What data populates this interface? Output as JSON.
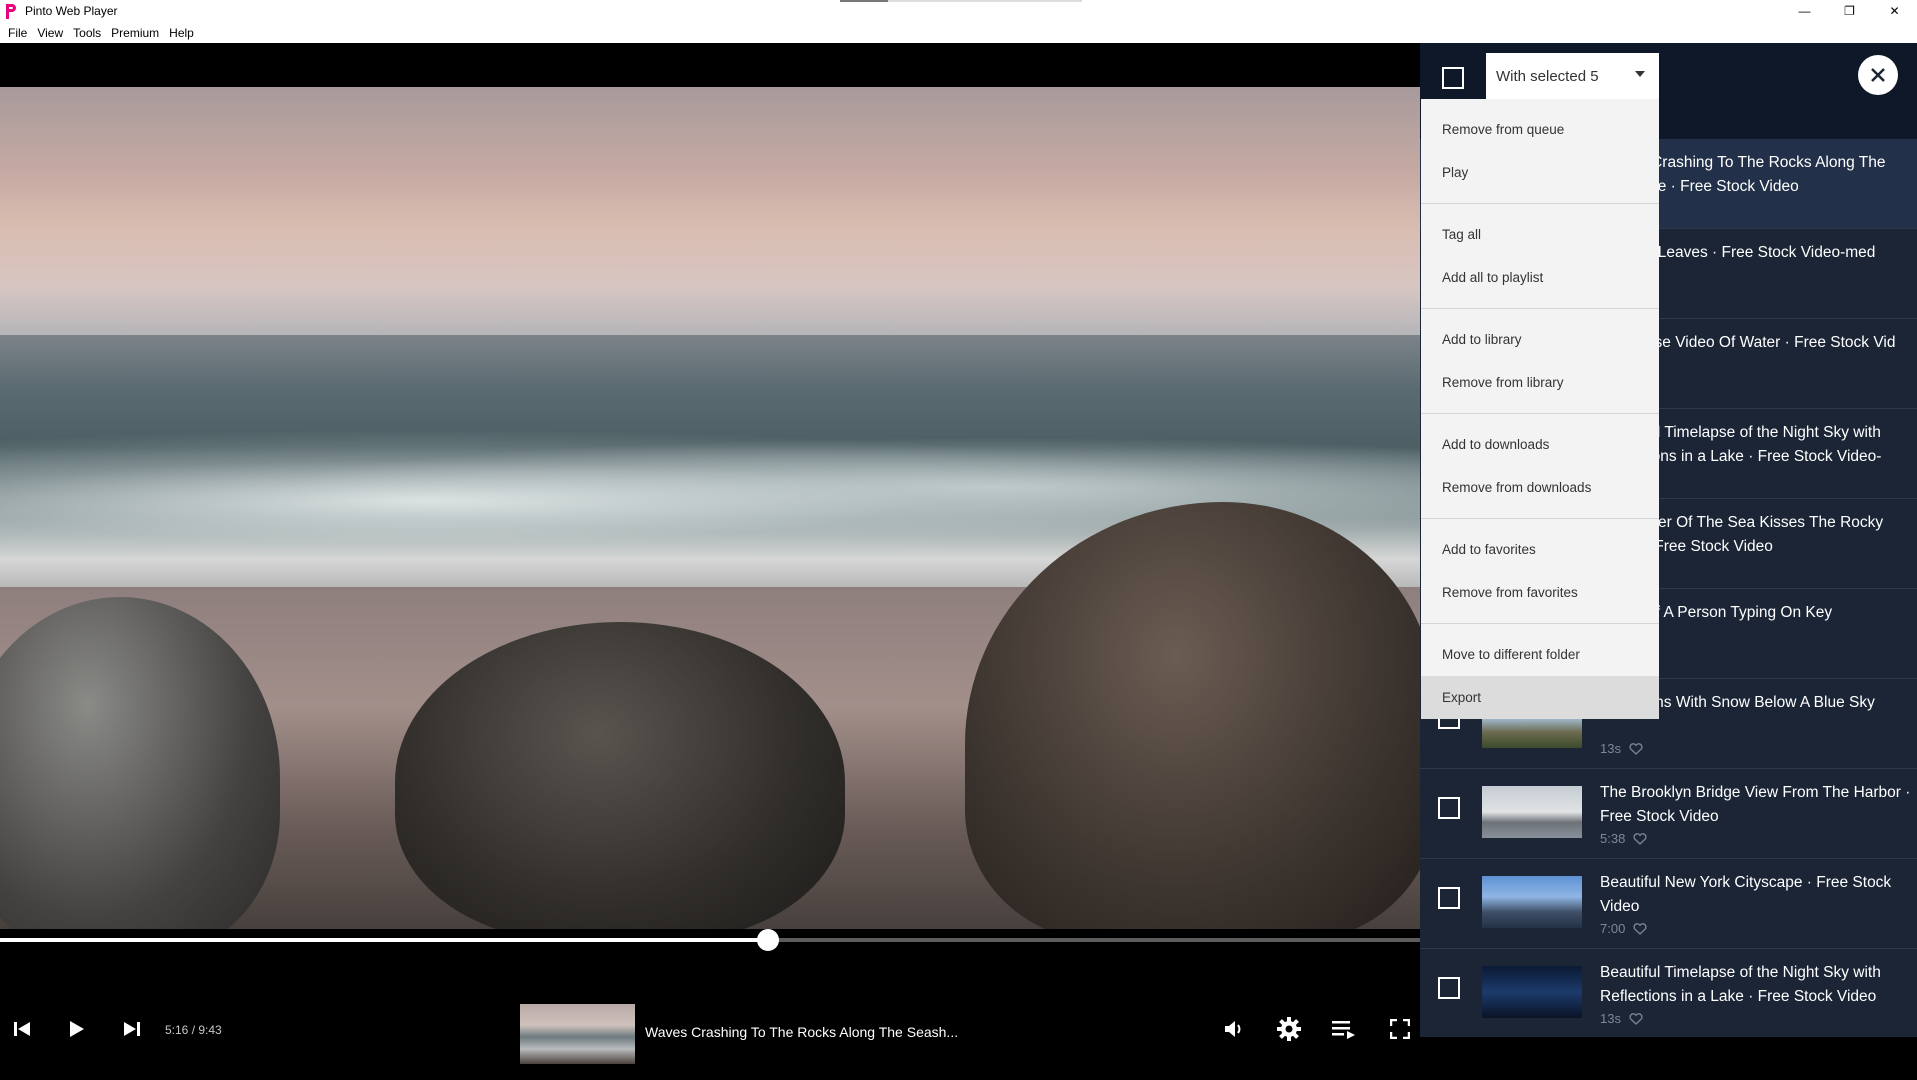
{
  "app": {
    "title": "Pinto Web Player"
  },
  "window_controls": {
    "minimize": "—",
    "restore": "❐",
    "close": "✕"
  },
  "menubar": [
    "File",
    "View",
    "Tools",
    "Premium",
    "Help"
  ],
  "player": {
    "time": "5:16 / 9:43",
    "progress_fraction": 0.541,
    "now_playing_title": "Waves Crashing To The Rocks Along The Seash..."
  },
  "queue": {
    "selection_label": "With selected 5",
    "items": [
      {
        "title": "Waves Crashing To The Rocks Along The Seashore · Free Stock Video",
        "meta": "",
        "checked": false
      },
      {
        "title": "Autumn Leaves · Free Stock Video-med",
        "meta": "",
        "checked": false
      },
      {
        "title": "Timelapse Video Of Water · Free Stock Vid",
        "meta": "",
        "checked": false
      },
      {
        "title": "Beautiful Timelapse of the Night Sky with Reflections in a Lake · Free Stock Video-medi",
        "meta": "",
        "checked": false
      },
      {
        "title": "The Water Of The Sea Kisses The Rocky Coast · Free Stock Video",
        "meta": "",
        "checked": false
      },
      {
        "title": "Video Of A Person Typing On Key",
        "meta": "",
        "checked": false
      },
      {
        "title": "Mountains With Snow Below A Blue Sky",
        "meta": "13s",
        "checked": false
      },
      {
        "title": "The Brooklyn Bridge View From The Harbor · Free Stock Video",
        "meta": "5:38",
        "checked": false
      },
      {
        "title": "Beautiful New York Cityscape · Free Stock Video",
        "meta": "7:00",
        "checked": false
      },
      {
        "title": "Beautiful Timelapse of the Night Sky with Reflections in a Lake · Free Stock Video",
        "meta": "13s",
        "checked": false
      }
    ]
  },
  "context_menu": {
    "groups": [
      [
        "Remove from queue",
        "Play"
      ],
      [
        "Tag all",
        "Add all to playlist"
      ],
      [
        "Add to library",
        "Remove from library"
      ],
      [
        "Add to downloads",
        "Remove from downloads"
      ],
      [
        "Add to favorites",
        "Remove from favorites"
      ],
      [
        "Move to different folder",
        "Export"
      ]
    ],
    "hovered": "Export"
  },
  "colors": {
    "accent": "#e6007e",
    "panel": "#1b2536",
    "panel_header": "#0f1828"
  }
}
